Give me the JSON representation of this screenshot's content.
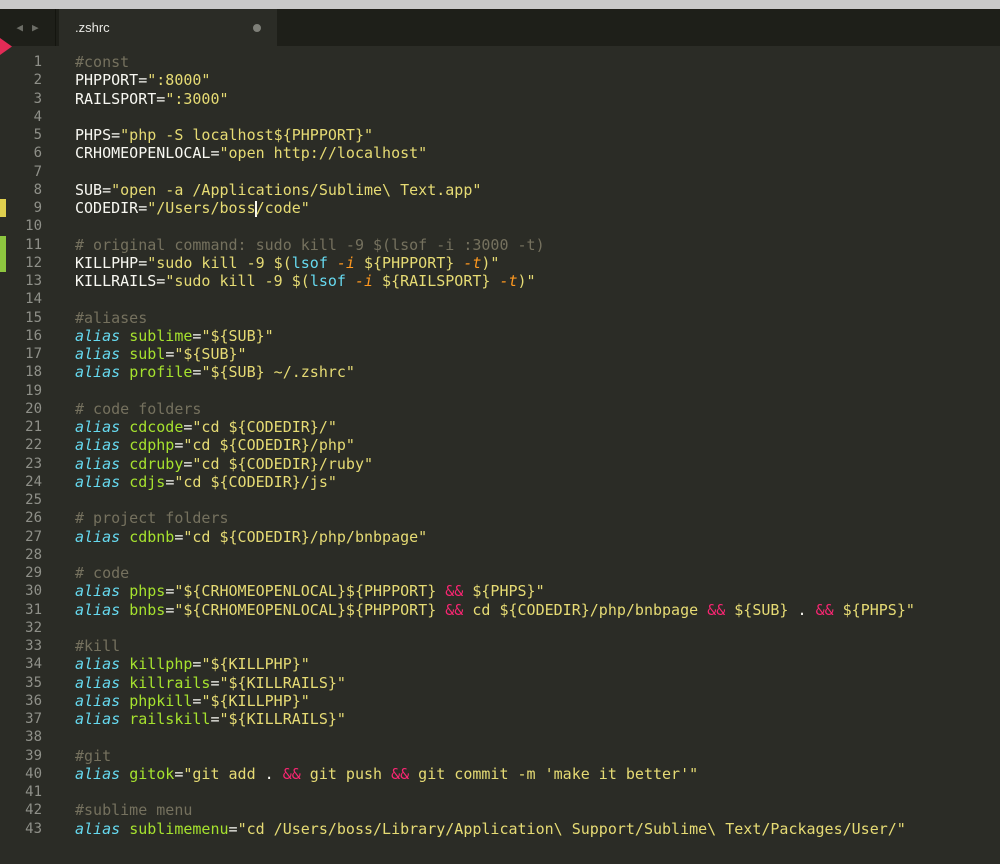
{
  "tab_bar": {
    "nav": {
      "back_glyph": "◀",
      "forward_glyph": "▶"
    },
    "tabs": [
      {
        "label": ".zshrc",
        "modified": true,
        "active": true
      }
    ]
  },
  "editor": {
    "background": "#2b2c26",
    "gutter_color": "#8f9089",
    "token_colors": {
      "c": "#75715e",
      "w": "#f8f8f2",
      "s": "#e6db74",
      "k": "#66d9ef",
      "g": "#a6e22e",
      "p": "#f92672",
      "b": "#66d9ef",
      "f": "#fd971f"
    },
    "italic_tokens": [
      "k",
      "f"
    ],
    "marker_colors": {
      "yellow": "#dfcf4e",
      "green": "#8dc63f"
    },
    "lines": [
      {
        "n": 1,
        "t": [
          [
            "c",
            "#const"
          ]
        ]
      },
      {
        "n": 2,
        "t": [
          [
            "w",
            "PHPPORT="
          ],
          [
            "s",
            "\":8000\""
          ]
        ]
      },
      {
        "n": 3,
        "t": [
          [
            "w",
            "RAILSPORT="
          ],
          [
            "s",
            "\":3000\""
          ]
        ]
      },
      {
        "n": 4,
        "t": []
      },
      {
        "n": 5,
        "t": [
          [
            "w",
            "PHPS="
          ],
          [
            "s",
            "\"php -S localhost${PHPPORT}\""
          ]
        ]
      },
      {
        "n": 6,
        "t": [
          [
            "w",
            "CRHOMEOPENLOCAL="
          ],
          [
            "s",
            "\"open http://localhost\""
          ]
        ]
      },
      {
        "n": 7,
        "t": []
      },
      {
        "n": 8,
        "t": [
          [
            "w",
            "SUB="
          ],
          [
            "s",
            "\"open -a /Applications/Sublime\\ Text.app\""
          ]
        ]
      },
      {
        "n": 9,
        "m": "yellow",
        "t": [
          [
            "w",
            "CODEDIR="
          ],
          [
            "s",
            "\"/Users/boss"
          ],
          [
            "cur",
            ""
          ],
          [
            "s",
            "/code\""
          ]
        ]
      },
      {
        "n": 10,
        "t": []
      },
      {
        "n": 11,
        "m": "green",
        "t": [
          [
            "c",
            "# original command: sudo kill -9 $(lsof -i :3000 -t)"
          ]
        ]
      },
      {
        "n": 12,
        "m": "green",
        "t": [
          [
            "w",
            "KILLPHP="
          ],
          [
            "s",
            "\"sudo kill -9 $("
          ],
          [
            "b",
            "lsof"
          ],
          [
            "s",
            " "
          ],
          [
            "f",
            "-i"
          ],
          [
            "s",
            " ${PHPPORT} "
          ],
          [
            "f",
            "-t"
          ],
          [
            "s",
            ")\""
          ]
        ]
      },
      {
        "n": 13,
        "t": [
          [
            "w",
            "KILLRAILS="
          ],
          [
            "s",
            "\"sudo kill -9 $("
          ],
          [
            "b",
            "lsof"
          ],
          [
            "s",
            " "
          ],
          [
            "f",
            "-i"
          ],
          [
            "s",
            " ${RAILSPORT} "
          ],
          [
            "f",
            "-t"
          ],
          [
            "s",
            ")\""
          ]
        ]
      },
      {
        "n": 14,
        "t": []
      },
      {
        "n": 15,
        "t": [
          [
            "c",
            "#aliases"
          ]
        ]
      },
      {
        "n": 16,
        "t": [
          [
            "k",
            "alias"
          ],
          [
            "w",
            " "
          ],
          [
            "g",
            "sublime"
          ],
          [
            "w",
            "="
          ],
          [
            "s",
            "\"${SUB}\""
          ]
        ]
      },
      {
        "n": 17,
        "t": [
          [
            "k",
            "alias"
          ],
          [
            "w",
            " "
          ],
          [
            "g",
            "subl"
          ],
          [
            "w",
            "="
          ],
          [
            "s",
            "\"${SUB}\""
          ]
        ]
      },
      {
        "n": 18,
        "t": [
          [
            "k",
            "alias"
          ],
          [
            "w",
            " "
          ],
          [
            "g",
            "profile"
          ],
          [
            "w",
            "="
          ],
          [
            "s",
            "\"${SUB} ~/.zshrc\""
          ]
        ]
      },
      {
        "n": 19,
        "t": []
      },
      {
        "n": 20,
        "t": [
          [
            "c",
            "# code folders"
          ]
        ]
      },
      {
        "n": 21,
        "t": [
          [
            "k",
            "alias"
          ],
          [
            "w",
            " "
          ],
          [
            "g",
            "cdcode"
          ],
          [
            "w",
            "="
          ],
          [
            "s",
            "\"cd ${CODEDIR}/\""
          ]
        ]
      },
      {
        "n": 22,
        "t": [
          [
            "k",
            "alias"
          ],
          [
            "w",
            " "
          ],
          [
            "g",
            "cdphp"
          ],
          [
            "w",
            "="
          ],
          [
            "s",
            "\"cd ${CODEDIR}/php\""
          ]
        ]
      },
      {
        "n": 23,
        "t": [
          [
            "k",
            "alias"
          ],
          [
            "w",
            " "
          ],
          [
            "g",
            "cdruby"
          ],
          [
            "w",
            "="
          ],
          [
            "s",
            "\"cd ${CODEDIR}/ruby\""
          ]
        ]
      },
      {
        "n": 24,
        "t": [
          [
            "k",
            "alias"
          ],
          [
            "w",
            " "
          ],
          [
            "g",
            "cdjs"
          ],
          [
            "w",
            "="
          ],
          [
            "s",
            "\"cd ${CODEDIR}/js\""
          ]
        ]
      },
      {
        "n": 25,
        "t": []
      },
      {
        "n": 26,
        "t": [
          [
            "c",
            "# project folders"
          ]
        ]
      },
      {
        "n": 27,
        "t": [
          [
            "k",
            "alias"
          ],
          [
            "w",
            " "
          ],
          [
            "g",
            "cdbnb"
          ],
          [
            "w",
            "="
          ],
          [
            "s",
            "\"cd ${CODEDIR}/php/bnbpage\""
          ]
        ]
      },
      {
        "n": 28,
        "t": []
      },
      {
        "n": 29,
        "t": [
          [
            "c",
            "# code"
          ]
        ]
      },
      {
        "n": 30,
        "t": [
          [
            "k",
            "alias"
          ],
          [
            "w",
            " "
          ],
          [
            "g",
            "phps"
          ],
          [
            "w",
            "="
          ],
          [
            "s",
            "\"${CRHOMEOPENLOCAL}${PHPPORT} "
          ],
          [
            "p",
            "&&"
          ],
          [
            "s",
            " ${PHPS}\""
          ]
        ]
      },
      {
        "n": 31,
        "t": [
          [
            "k",
            "alias"
          ],
          [
            "w",
            " "
          ],
          [
            "g",
            "bnbs"
          ],
          [
            "w",
            "="
          ],
          [
            "s",
            "\"${CRHOMEOPENLOCAL}${PHPPORT} "
          ],
          [
            "p",
            "&&"
          ],
          [
            "s",
            " cd ${CODEDIR}/php/bnbpage "
          ],
          [
            "p",
            "&&"
          ],
          [
            "s",
            " ${SUB} "
          ],
          [
            "w",
            "."
          ],
          [
            "s",
            " "
          ],
          [
            "p",
            "&&"
          ],
          [
            "s",
            " ${PHPS}\""
          ]
        ]
      },
      {
        "n": 32,
        "t": []
      },
      {
        "n": 33,
        "t": [
          [
            "c",
            "#kill"
          ]
        ]
      },
      {
        "n": 34,
        "t": [
          [
            "k",
            "alias"
          ],
          [
            "w",
            " "
          ],
          [
            "g",
            "killphp"
          ],
          [
            "w",
            "="
          ],
          [
            "s",
            "\"${KILLPHP}\""
          ]
        ]
      },
      {
        "n": 35,
        "t": [
          [
            "k",
            "alias"
          ],
          [
            "w",
            " "
          ],
          [
            "g",
            "killrails"
          ],
          [
            "w",
            "="
          ],
          [
            "s",
            "\"${KILLRAILS}\""
          ]
        ]
      },
      {
        "n": 36,
        "t": [
          [
            "k",
            "alias"
          ],
          [
            "w",
            " "
          ],
          [
            "g",
            "phpkill"
          ],
          [
            "w",
            "="
          ],
          [
            "s",
            "\"${KILLPHP}\""
          ]
        ]
      },
      {
        "n": 37,
        "t": [
          [
            "k",
            "alias"
          ],
          [
            "w",
            " "
          ],
          [
            "g",
            "railskill"
          ],
          [
            "w",
            "="
          ],
          [
            "s",
            "\"${KILLRAILS}\""
          ]
        ]
      },
      {
        "n": 38,
        "t": []
      },
      {
        "n": 39,
        "t": [
          [
            "c",
            "#git"
          ]
        ]
      },
      {
        "n": 40,
        "t": [
          [
            "k",
            "alias"
          ],
          [
            "w",
            " "
          ],
          [
            "g",
            "gitok"
          ],
          [
            "w",
            "="
          ],
          [
            "s",
            "\"git add "
          ],
          [
            "w",
            "."
          ],
          [
            "s",
            " "
          ],
          [
            "p",
            "&&"
          ],
          [
            "s",
            " git push "
          ],
          [
            "p",
            "&&"
          ],
          [
            "s",
            " git commit -m 'make it better'\""
          ]
        ]
      },
      {
        "n": 41,
        "t": []
      },
      {
        "n": 42,
        "t": [
          [
            "c",
            "#sublime menu"
          ]
        ]
      },
      {
        "n": 43,
        "t": [
          [
            "k",
            "alias"
          ],
          [
            "w",
            " "
          ],
          [
            "g",
            "sublimemenu"
          ],
          [
            "w",
            "="
          ],
          [
            "s",
            "\"cd /Users/boss/Library/Application\\ Support/Sublime\\ Text/Packages/User/\""
          ]
        ]
      }
    ]
  }
}
